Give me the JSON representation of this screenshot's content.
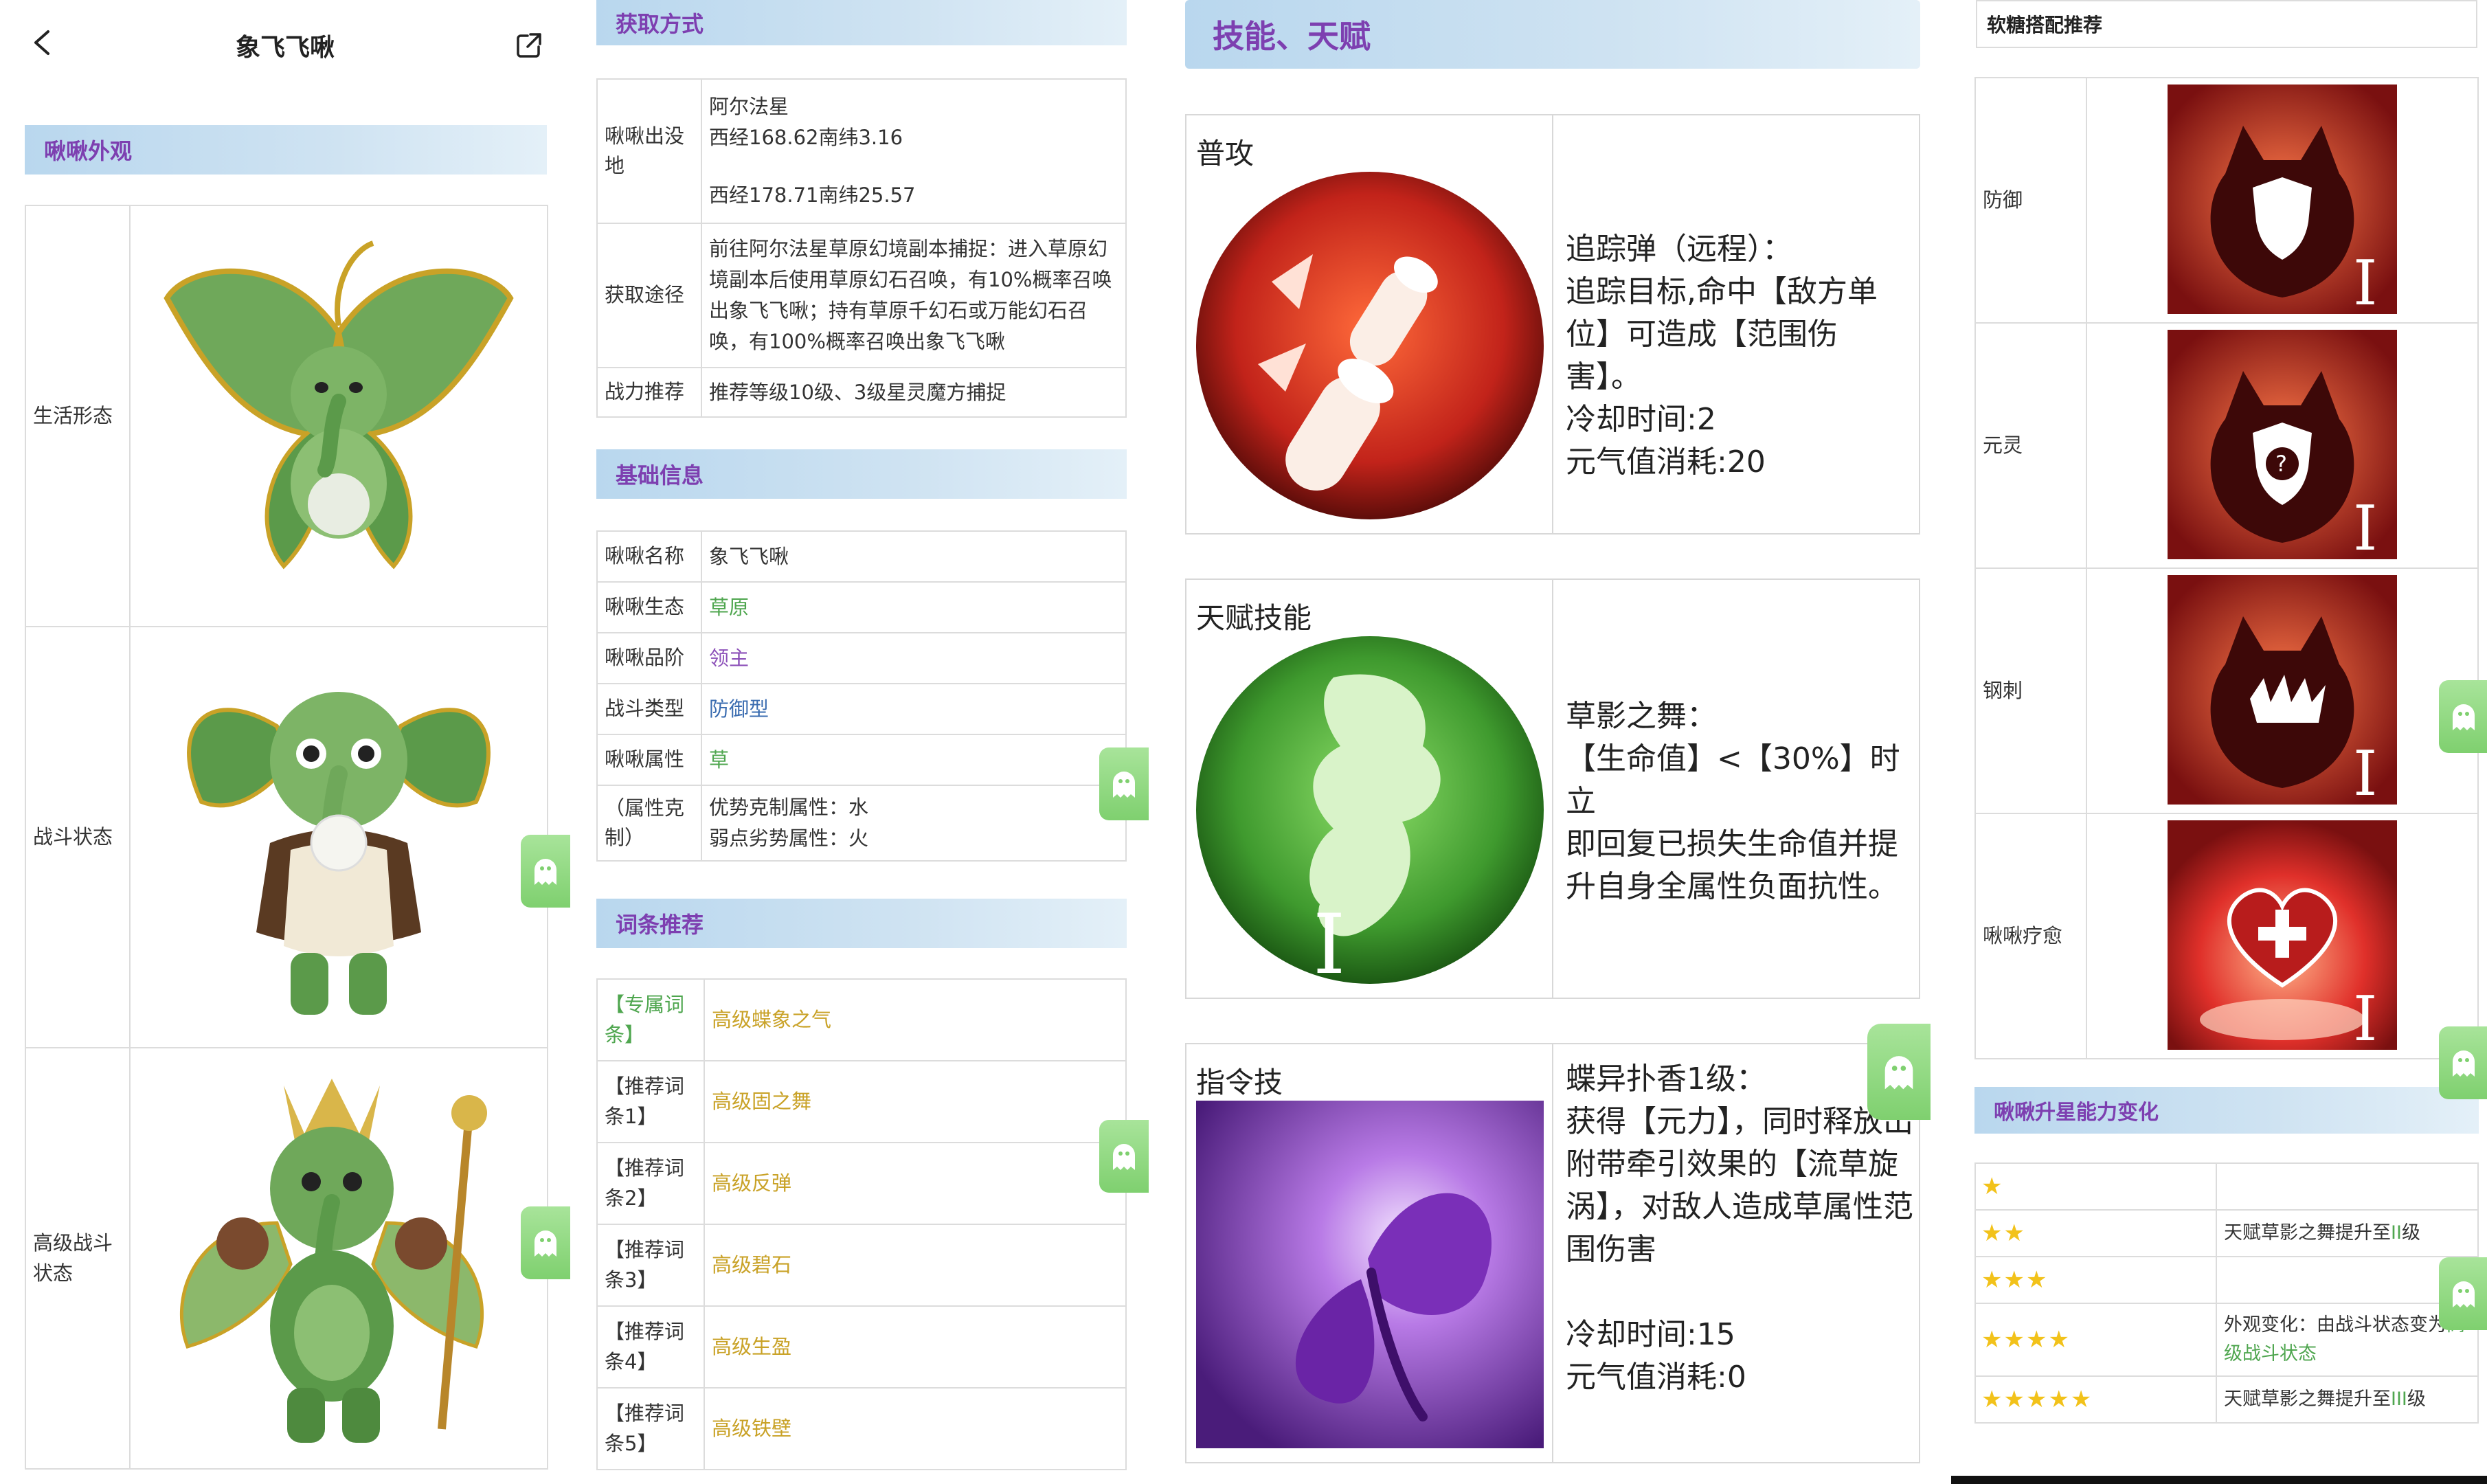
{
  "header": {
    "title": "象飞飞啾",
    "back_label": "back",
    "share_label": "share"
  },
  "appearance": {
    "section_title": "啾啾外观",
    "rows": [
      {
        "label": "生活形态"
      },
      {
        "label": "战斗状态"
      },
      {
        "label": "高级战斗状态"
      }
    ]
  },
  "acquire": {
    "section_title": "获取方式",
    "location_label": "啾啾出没地",
    "location_lines": [
      "阿尔法星",
      "西经168.62南纬3.16",
      "西经178.71南纬25.57"
    ],
    "route_label": "获取途径",
    "route_text": "前往阿尔法星草原幻境副本捕捉：进入草原幻境副本后使用草原幻石召唤，有10%概率召唤出象飞飞啾；持有草原千幻石或万能幻石召唤，有100%概率召唤出象飞飞啾",
    "power_label": "战力推荐",
    "power_text": "推荐等级10级、3级星灵魔方捕捉"
  },
  "basic": {
    "section_title": "基础信息",
    "rows": [
      {
        "label": "啾啾名称",
        "value": "象飞飞啾"
      },
      {
        "label": "啾啾生态",
        "value": "草原"
      },
      {
        "label": "啾啾品阶",
        "value": "领主"
      },
      {
        "label": "战斗类型",
        "value": "防御型"
      },
      {
        "label": "啾啾属性",
        "value": "草"
      }
    ],
    "counter_label": "（属性克制）",
    "counter_lines": [
      "优势克制属性：水",
      "弱点劣势属性：火"
    ]
  },
  "entries": {
    "section_title": "词条推荐",
    "rows": [
      {
        "label": "【专属词条】",
        "value": "高级蝶象之气"
      },
      {
        "label": "【推荐词条1】",
        "value": "高级固之舞"
      },
      {
        "label": "【推荐词条2】",
        "value": "高级反弹"
      },
      {
        "label": "【推荐词条3】",
        "value": "高级碧石"
      },
      {
        "label": "【推荐词条4】",
        "value": "高级生盈"
      },
      {
        "label": "【推荐词条5】",
        "value": "高级铁壁"
      }
    ]
  },
  "skills": {
    "section_title": "技能、天赋",
    "items": [
      {
        "name": "普攻",
        "icon": "missile-icon",
        "desc": [
          "追踪弹（远程）：",
          "追踪目标,命中【敌方单",
          "位】可造成【范围伤害】。",
          "冷却时间:2",
          "元气值消耗:20"
        ]
      },
      {
        "name": "天赋技能",
        "icon": "grass-leaf-icon",
        "badge": "I",
        "desc": [
          "草影之舞：",
          "【生命值】<【30%】时立",
          "即回复已损失生命值并提",
          "升自身全属性负面抗性。"
        ]
      },
      {
        "name": "指令技",
        "icon": "butterfly-icon",
        "desc": [
          "蝶异扑香1级：",
          "获得【元力】，同时释放出",
          "附带牵引效果的【流草旋",
          "涡】，对敌人造成草属性范",
          "围伤害",
          "",
          "冷却时间:15",
          "元气值消耗:0"
        ]
      }
    ]
  },
  "candy": {
    "section_title": "软糖搭配推荐",
    "rows": [
      {
        "label": "防御",
        "icon": "defense-shield-icon",
        "badge": "I"
      },
      {
        "label": "元灵",
        "icon": "spirit-shield-icon",
        "badge": "I"
      },
      {
        "label": "钢刺",
        "icon": "steel-spike-icon",
        "badge": "I"
      },
      {
        "label": "啾啾疗愈",
        "icon": "heal-heart-icon",
        "badge": "I"
      }
    ]
  },
  "star_up": {
    "section_title": "啾啾升星能力变化",
    "rows": [
      {
        "stars": "★",
        "text": ""
      },
      {
        "stars": "★★",
        "text_pre": "天赋草影之舞提升至",
        "text_hl": "II",
        "text_post": "级"
      },
      {
        "stars": "★★★",
        "text": ""
      },
      {
        "stars": "★★★★",
        "text_pre": "外观变化：由战斗状态变为",
        "text_hl": "高级战斗状态",
        "text_post": ""
      },
      {
        "stars": "★★★★★",
        "text_pre": "天赋草影之舞提升至",
        "text_hl": "III",
        "text_post": "级"
      }
    ]
  },
  "colors": {
    "section_purple": "#7d3fb0",
    "green_text": "#4fa64f",
    "gold_text": "#c9a227",
    "star": "#f2c21a",
    "tab_green": "#8fd680"
  }
}
